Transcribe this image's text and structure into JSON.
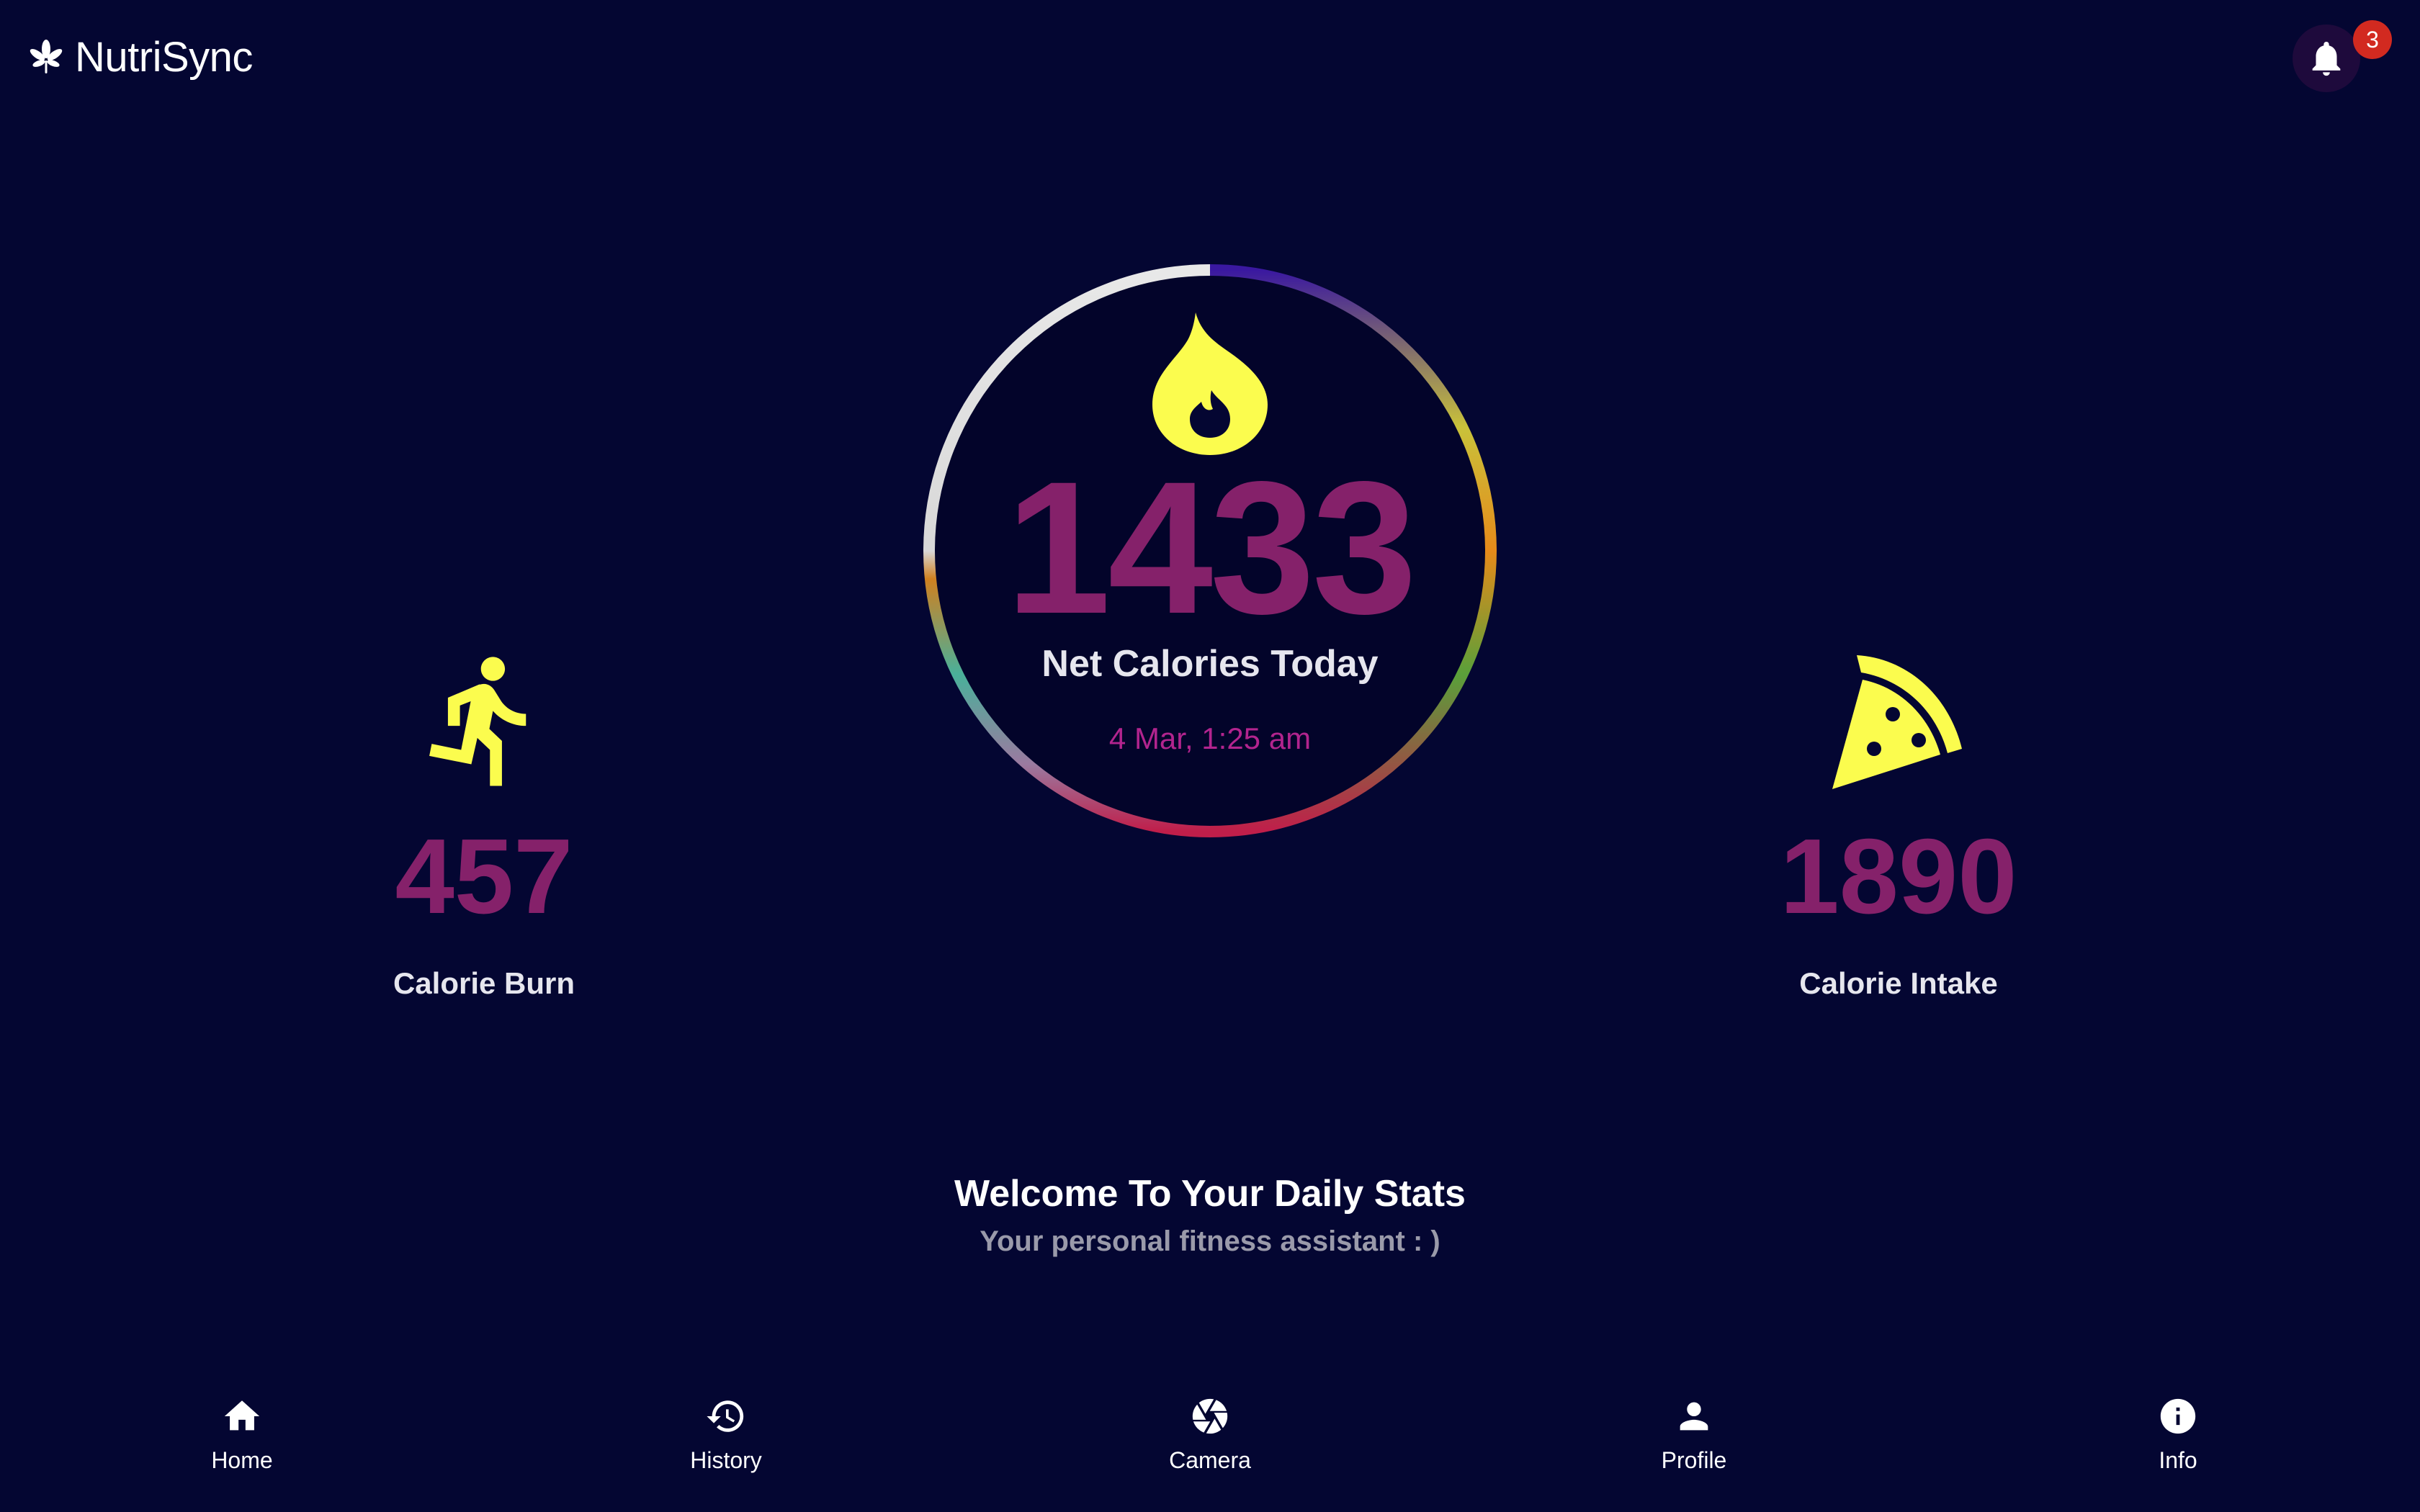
{
  "header": {
    "app_name": "NutriSync",
    "logo_icon": "leaf-icon",
    "notification_icon": "bell-icon",
    "notification_count": "3"
  },
  "net_calories": {
    "icon": "flame-icon",
    "value": "1433",
    "label": "Net Calories Today",
    "timestamp": "4 Mar, 1:25 am"
  },
  "calorie_burn": {
    "icon": "running-icon",
    "value": "457",
    "label": "Calorie Burn"
  },
  "calorie_intake": {
    "icon": "pizza-icon",
    "value": "1890",
    "label": "Calorie Intake"
  },
  "welcome": {
    "title": "Welcome To Your Daily Stats",
    "subtitle": "Your personal fitness assistant : )"
  },
  "nav": {
    "items": [
      {
        "label": "Home",
        "icon": "home-icon"
      },
      {
        "label": "History",
        "icon": "history-icon"
      },
      {
        "label": "Camera",
        "icon": "camera-icon"
      },
      {
        "label": "Profile",
        "icon": "profile-icon"
      },
      {
        "label": "Info",
        "icon": "info-icon"
      }
    ]
  },
  "colors": {
    "background": "#040632",
    "value_magenta": "#85216a",
    "date_magenta": "#b2248e",
    "icon_yellow": "#fbfc4e",
    "badge_red": "#d22a20"
  }
}
